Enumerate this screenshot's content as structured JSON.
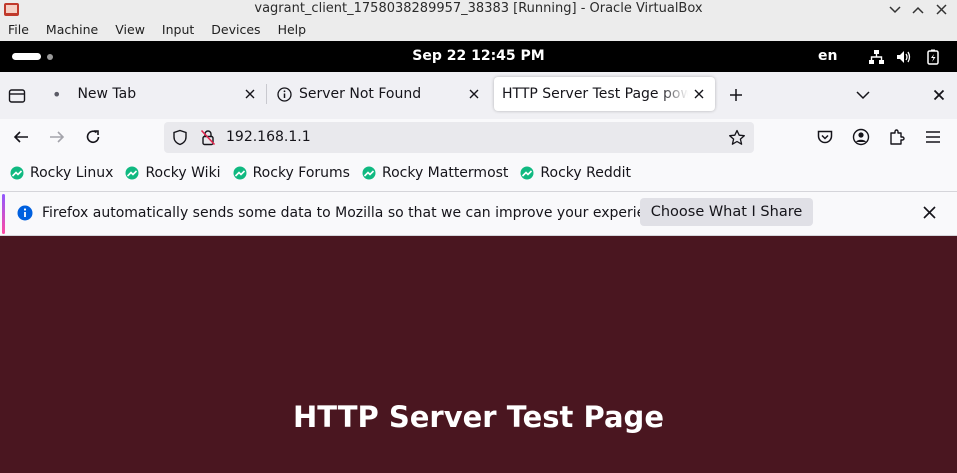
{
  "vbox": {
    "title": "vagrant_client_1758038289957_38383 [Running] - Oracle VirtualBox",
    "menu": [
      "File",
      "Machine",
      "View",
      "Input",
      "Devices",
      "Help"
    ]
  },
  "gnome": {
    "clock": "Sep 22  12:45 PM",
    "lang": "en"
  },
  "tabs": [
    {
      "label": "New Tab",
      "active": false
    },
    {
      "label": "Server Not Found",
      "active": false
    },
    {
      "label": "HTTP Server Test Page powe",
      "active": true
    }
  ],
  "nav": {
    "url": "192.168.1.1"
  },
  "bookmarks": [
    "Rocky Linux",
    "Rocky Wiki",
    "Rocky Forums",
    "Rocky Mattermost",
    "Rocky Reddit"
  ],
  "notification": {
    "text": "Firefox automatically sends some data to Mozilla so that we can improve your experience.",
    "button": "Choose What I Share"
  },
  "page": {
    "heading": "HTTP Server Test Page"
  },
  "colors": {
    "page_background": "#4a1620",
    "bookmark_icon": "#10b981",
    "info_icon": "#0060df"
  }
}
